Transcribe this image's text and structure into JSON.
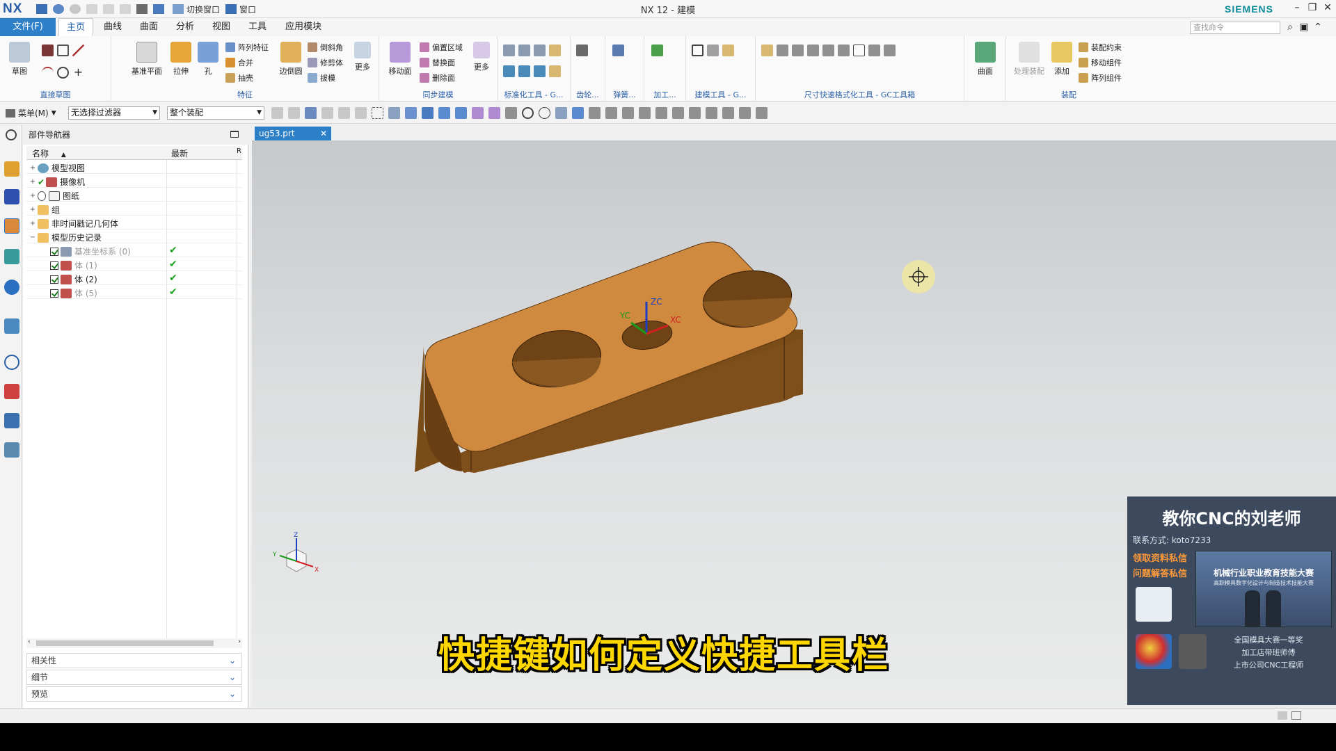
{
  "app": {
    "logo": "NX",
    "title": "NX 12 - 建模",
    "brand": "SIEMENS",
    "switch_window": "切换窗口",
    "window": "窗口"
  },
  "menu_tabs": {
    "file": "文件(F)",
    "items": [
      "主页",
      "曲线",
      "曲面",
      "分析",
      "视图",
      "工具",
      "应用模块"
    ]
  },
  "search": {
    "placeholder": "查找命令"
  },
  "ribbon": {
    "sketch": {
      "label": "草图",
      "group": "直接草图"
    },
    "feature": {
      "datum": "基准平面",
      "extrude": "拉伸",
      "hole": "孔",
      "pattern": "阵列特征",
      "unite": "合并",
      "shell": "抽壳",
      "edge_blend": "边倒圆",
      "chamfer": "倒斜角",
      "trim_body": "修剪体",
      "draft": "拔模",
      "more": "更多",
      "group": "特征"
    },
    "sync": {
      "move_face": "移动面",
      "offset_region": "偏置区域",
      "replace_face": "替换面",
      "delete_face": "删除面",
      "more": "更多",
      "group": "同步建模"
    },
    "groups": {
      "std_tools": "标准化工具 - G...",
      "gear": "齿轮...",
      "spring": "弹簧...",
      "machining": "加工...",
      "modeling_tools": "建模工具 - G...",
      "dim_tools": "尺寸快速格式化工具 - GC工具箱",
      "surface": "曲面",
      "assembly": "装配"
    },
    "assembly": {
      "process_assy": "处理装配",
      "add": "添加",
      "assy_constraints": "装配约束",
      "move_component": "移动组件",
      "pattern_component": "阵列组件"
    }
  },
  "filterbar": {
    "menu": "菜单(M)",
    "filter": "无选择过滤器",
    "scope": "整个装配"
  },
  "navigator": {
    "title": "部件导航器",
    "col_name": "名称",
    "col_newest": "最新",
    "col_extra": "R",
    "rows": [
      {
        "label": "模型视图",
        "newest": ""
      },
      {
        "label": "摄像机",
        "newest": ""
      },
      {
        "label": "图纸",
        "newest": ""
      },
      {
        "label": "组",
        "newest": ""
      },
      {
        "label": "非时间戳记几何体",
        "newest": ""
      },
      {
        "label": "模型历史记录",
        "newest": ""
      },
      {
        "label": "基准坐标系 (0)",
        "newest": "✔"
      },
      {
        "label": "体 (1)",
        "newest": "✔"
      },
      {
        "label": "体 (2)",
        "newest": "✔"
      },
      {
        "label": "体 (5)",
        "newest": "✔"
      }
    ],
    "panels": [
      "相关性",
      "细节",
      "预览"
    ]
  },
  "document": {
    "tab": "ug53.prt"
  },
  "viewport": {
    "axis_labels": {
      "zc": "ZC",
      "yc": "YC",
      "xc": "XC"
    },
    "triad_labels": {
      "z": "Z",
      "y": "Y",
      "x": "X"
    },
    "part_color": "#d08a40"
  },
  "subtitle": "快捷键如何定义快捷工具栏",
  "promo": {
    "title": "教你CNC的刘老师",
    "contact": "联系方式:   koto7233",
    "line1": "领取资料私信",
    "line2": "问题解答私信",
    "photo_title": "机械行业职业教育技能大赛",
    "photo_sub": "高职模具数字化设计与制造技术技能大赛",
    "bio": [
      "全国模具大赛一等奖",
      "加工店带班师傅",
      "上市公司CNC工程师"
    ]
  }
}
